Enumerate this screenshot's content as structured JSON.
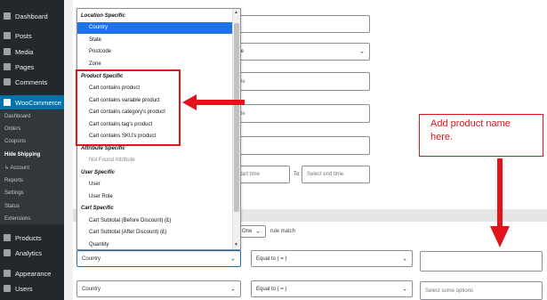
{
  "sidebar": {
    "items": [
      {
        "label": "Dashboard",
        "icon": "dashboard-icon"
      },
      {
        "label": "Posts",
        "icon": "pin-icon"
      },
      {
        "label": "Media",
        "icon": "media-icon"
      },
      {
        "label": "Pages",
        "icon": "pages-icon"
      },
      {
        "label": "Comments",
        "icon": "comments-icon"
      },
      {
        "label": "WooCommerce",
        "icon": "woocommerce-icon",
        "active": true
      },
      {
        "label": "Products",
        "icon": "products-icon"
      },
      {
        "label": "Analytics",
        "icon": "analytics-icon"
      },
      {
        "label": "Appearance",
        "icon": "appearance-icon"
      },
      {
        "label": "Users",
        "icon": "users-icon"
      }
    ],
    "submenu": [
      "Dashboard",
      "Orders",
      "Coupons",
      "Hide Shipping",
      "↳ Account",
      "Reports",
      "Settings",
      "Status",
      "Extensions"
    ],
    "current_submenu": "Hide Shipping"
  },
  "dropdown": {
    "groups": [
      {
        "label": "Location Specific",
        "options": [
          {
            "label": "Country",
            "selected": true
          },
          {
            "label": "State"
          },
          {
            "label": "Postcode"
          },
          {
            "label": "Zone"
          }
        ]
      },
      {
        "label": "Product Specific",
        "options": [
          {
            "label": "Cart contains product"
          },
          {
            "label": "Cart contains variable product"
          },
          {
            "label": "Cart contains category's product"
          },
          {
            "label": "Cart contains tag's product"
          },
          {
            "label": "Cart contains SKU's product"
          }
        ]
      },
      {
        "label": "Attribute Specific",
        "options": [
          {
            "label": "Not Found Attribute",
            "disabled": true
          }
        ]
      },
      {
        "label": "User Specific",
        "options": [
          {
            "label": "User"
          },
          {
            "label": "User Role"
          }
        ]
      },
      {
        "label": "Cart Specific",
        "options": [
          {
            "label": "Cart Subtotal (Before Discount) (£)"
          },
          {
            "label": "Cart Subtotal (After Discount) (£)"
          },
          {
            "label": "Quantity"
          }
        ]
      }
    ]
  },
  "form": {
    "rule_select": "rule",
    "date1_placeholder": "date",
    "date2_placeholder": "date",
    "start_time_placeholder": "t start time",
    "to_label": "To:",
    "end_time_placeholder": "Select end time",
    "any_one_select": "ny One",
    "rule_match_label": "rule match",
    "row1": {
      "field": "Country",
      "operator": "Equal to ( = )",
      "value": ""
    },
    "row2": {
      "field": "Country",
      "operator": "Equal to ( = )",
      "value_placeholder": "Select some options"
    }
  },
  "annotation": {
    "callout_text": "Add product name here.",
    "color": "#e3131b"
  },
  "colors": {
    "sidebar_bg": "#23282d",
    "active_menu": "#0073aa",
    "selected_option": "#1e73e8"
  }
}
